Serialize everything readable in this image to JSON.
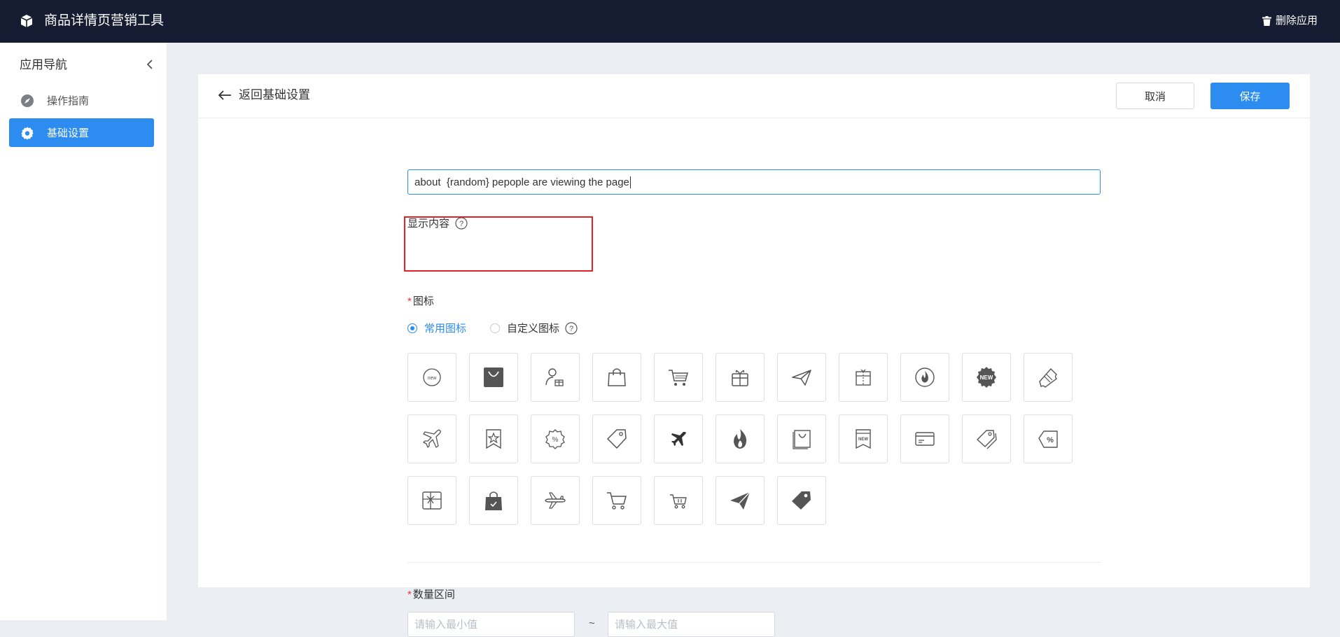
{
  "app": {
    "title": "商品详情页营销工具",
    "delete_label": "删除应用"
  },
  "sidebar": {
    "title": "应用导航",
    "items": [
      {
        "label": "操作指南",
        "icon": "compass-icon",
        "active": false
      },
      {
        "label": "基础设置",
        "icon": "gear-icon",
        "active": true
      }
    ]
  },
  "header": {
    "back_label": "返回基础设置",
    "cancel_label": "取消",
    "save_label": "保存"
  },
  "form": {
    "content_label": "显示内容",
    "content_value": "about  {random} pepople are viewing the page",
    "icon_label": "图标",
    "icon_options": [
      "常用图标",
      "自定义图标"
    ],
    "icon_selected": "常用图标",
    "icons": [
      "new-badge-icon",
      "shopping-bag-filled-icon",
      "person-gift-icon",
      "shopping-bag-icon",
      "shopping-cart-icon",
      "gift-box-icon",
      "paper-plane-icon",
      "gift-box-outline-icon",
      "flame-circle-icon",
      "new-seal-icon",
      "ticket-icon",
      "airplane-icon",
      "bookmark-star-icon",
      "discount-badge-icon",
      "price-tag-icon",
      "airplane-filled-icon",
      "fire-icon",
      "shopping-bag-square-icon",
      "new-label-icon",
      "credit-card-icon",
      "double-tag-icon",
      "percent-tag-icon",
      "gift-card-icon",
      "shopping-bag-check-icon",
      "airplane-side-icon",
      "cart-outline-icon",
      "cart-small-icon",
      "paper-plane-filled-icon",
      "tag-filled-icon"
    ],
    "range_label": "数量区间",
    "min_placeholder": "请输入最小值",
    "max_placeholder": "请输入最大值",
    "range_separator": "~"
  },
  "colors": {
    "topbar": "#161d32",
    "accent": "#2c8cf0",
    "highlight": "#e32228",
    "background": "#ebeef3"
  }
}
